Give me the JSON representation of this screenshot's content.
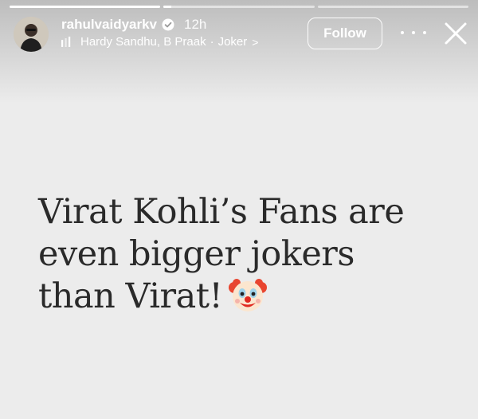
{
  "progress_bars": [
    1,
    0.05,
    0
  ],
  "header": {
    "username": "rahulvaidyarkv",
    "timestamp": "12h",
    "verified_icon": "verified-badge-icon",
    "music_artists": "Hardy Sandhu, B Praak",
    "music_separator": "·",
    "music_song": "Joker",
    "music_chevron": ">",
    "follow_label": "Follow"
  },
  "story": {
    "lines": [
      "Virat Kohli’s Fans are",
      "even bigger jokers",
      "than Virat!"
    ],
    "emoji": "clown-face-icon"
  },
  "colors": {
    "text": "#2a2a2a",
    "background": "#ececec",
    "overlay_text": "#ffffff"
  }
}
